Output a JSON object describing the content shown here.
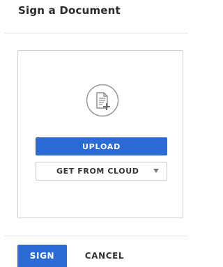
{
  "dialog": {
    "title": "Sign a Document"
  },
  "dropzone": {
    "icon": "add-document-icon",
    "upload_label": "UPLOAD",
    "cloud_select_label": "GET FROM CLOUD",
    "cloud_select_icon": "caret-down-icon"
  },
  "footer": {
    "sign_label": "SIGN",
    "cancel_label": "CANCEL"
  },
  "colors": {
    "accent": "#2b6bd6",
    "text": "#2b2b2b",
    "border": "#cfcfcf"
  }
}
